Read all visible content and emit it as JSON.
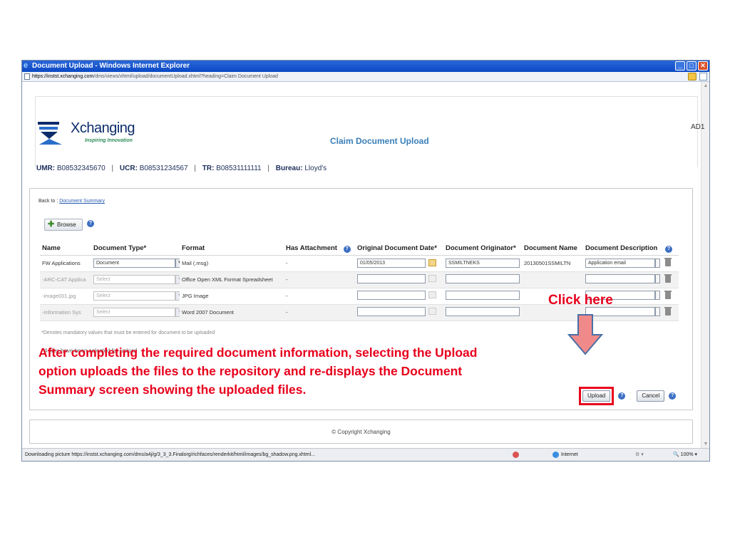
{
  "window": {
    "title": "Document Upload - Windows Internet Explorer",
    "url_host": "https://instst.xchanging.com",
    "url_path": "/dms/views/xhtml/upload/documentUpload.xhtml?heading=Claim Document Upload"
  },
  "header": {
    "logo_name": "Xchanging",
    "logo_tagline": "Inspiring Innovation",
    "page_title": "Claim Document Upload",
    "user_code": "AD1"
  },
  "refs": {
    "umr_label": "UMR:",
    "umr_value": "B08532345670",
    "ucr_label": "UCR:",
    "ucr_value": "B08531234567",
    "tr_label": "TR:",
    "tr_value": "B08531111111",
    "bureau_label": "Bureau:",
    "bureau_value": "Lloyd's",
    "separator": "|"
  },
  "back": {
    "prefix": "Back to :",
    "link": "Document Summary"
  },
  "browse_label": "Browse",
  "help_glyph": "?",
  "table": {
    "headers": {
      "name": "Name",
      "doc_type": "Document Type*",
      "format": "Format",
      "has_attachment": "Has Attachment",
      "orig_date": "Original Document Date*",
      "originator": "Document Originator*",
      "doc_name": "Document Name",
      "description": "Document Description"
    },
    "rows": [
      {
        "name": "FW Applications",
        "doc_type": "Document",
        "format": "Mail (.msg)",
        "has_attachment": "-",
        "orig_date": "01/05/2013",
        "originator": "SSMILTNEKS",
        "doc_name": "20130501SSMILTN",
        "description": "Application email"
      },
      {
        "name": "-ARC-CAT Applica",
        "doc_type": "Select",
        "format": "Office Open XML Format Spreadsheet",
        "has_attachment": "-",
        "orig_date": "",
        "originator": "",
        "doc_name": "",
        "description": ""
      },
      {
        "name": "-image001.jpg",
        "doc_type": "Select",
        "format": "JPG Image",
        "has_attachment": "-",
        "orig_date": "",
        "originator": "",
        "doc_name": "",
        "description": ""
      },
      {
        "name": "-Information Sys",
        "doc_type": "Select",
        "format": "Word 2007 Document",
        "has_attachment": "-",
        "orig_date": "",
        "originator": "",
        "doc_name": "",
        "description": ""
      }
    ]
  },
  "mandatory_note": "*Denotes mandatory values that must be entered for document to be uploaded",
  "files_selected": "4 files have been selected for upload",
  "actions": {
    "upload": "Upload",
    "cancel": "Cancel"
  },
  "footer": "© Copyright Xchanging",
  "statusbar": {
    "message": "Downloading picture https://instst.xchanging.com/dms/a4j/g/3_3_3.Finalorg/richfaces/renderkit/html/images/bg_shadow.png.xhtml...",
    "zone": "Internet",
    "zoom": "100%"
  },
  "annotations": {
    "callout": "Click here",
    "line1": "After completing the required document information, selecting the Upload",
    "line2": "option uploads the files to the repository and re-displays the Document",
    "line3": "Summary screen showing the uploaded files."
  },
  "colors": {
    "annotation": "#e8001c",
    "titlebar": "#0b49c4",
    "brand_navy": "#0b2b6a",
    "title_blue": "#3a7fb8"
  }
}
